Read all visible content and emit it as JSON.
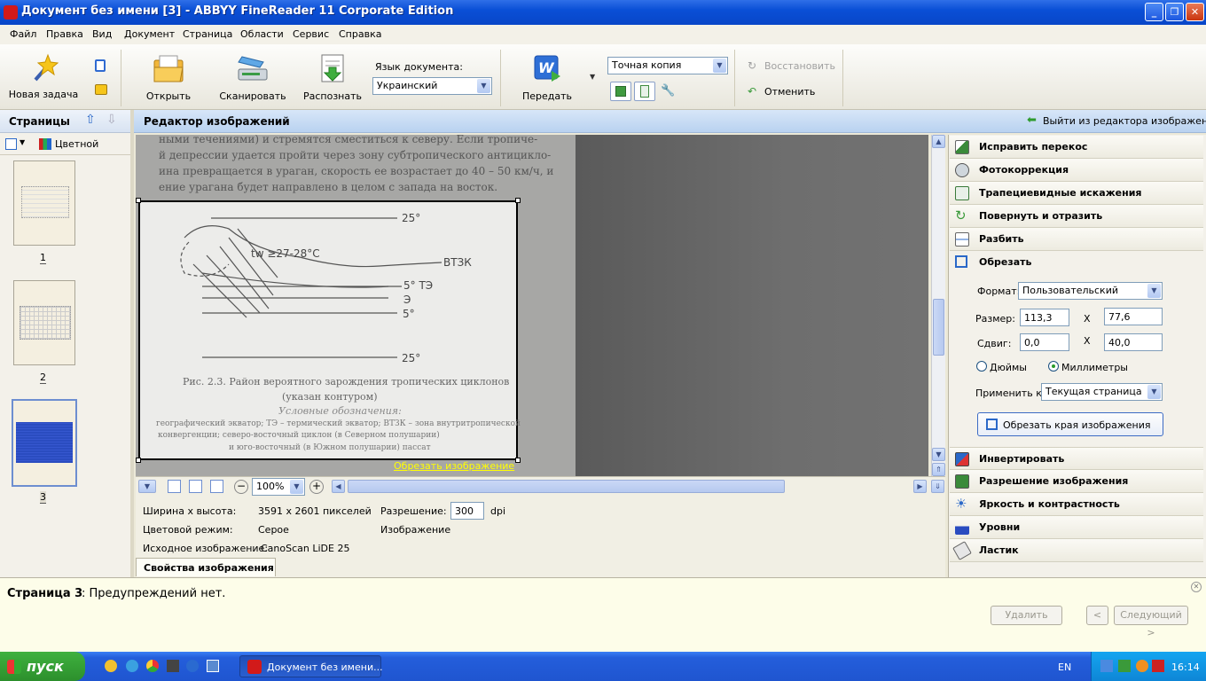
{
  "window": {
    "title": "Документ без имени [3] - ABBYY FineReader 11 Corporate Edition",
    "min": "_",
    "max": "❐",
    "close": "✕"
  },
  "menu": [
    "Файл",
    "Правка",
    "Вид",
    "Документ",
    "Страница",
    "Области",
    "Сервис",
    "Справка"
  ],
  "toolbar": {
    "new_task": "Новая задача",
    "open": "Открыть",
    "scan": "Сканировать",
    "recognize": "Распознать",
    "doc_language_label": "Язык документа:",
    "doc_language": "Украинский",
    "send": "Передать",
    "send_icon_letter": "W",
    "format": "Точная копия",
    "restore": "Восстановить",
    "undo": "Отменить"
  },
  "pages": {
    "title": "Страницы",
    "color_mode": "Цветной",
    "items": [
      {
        "num": "1"
      },
      {
        "num": "2"
      },
      {
        "num": "3"
      }
    ]
  },
  "editor": {
    "title": "Редактор изображений",
    "exit": "Выйти из редактора изображений"
  },
  "image_text": {
    "top_lines": [
      "ными течениями) и стремятся сместиться к северу. Если тропиче-",
      "й депрессии удается пройти через зону субтропического антицикло-",
      "ина превращается в ураган, скорость ее возрастает до 40 – 50 км/ч, и",
      "ение урагана будет направлено в целом с запада на восток."
    ],
    "sketch": {
      "lat_25_top": "25°",
      "tw": "tw ≥27-28°C",
      "vtzk": "ВТЗК",
      "te": "5° ТЭ",
      "e": "Э",
      "lat_5": "5°",
      "lat_25_bottom": "25°"
    },
    "caption_lines": [
      "Рис. 2.3. Район вероятного зарождения тропических циклонов",
      "(указан контуром)",
      "Условные обозначения:",
      "географический экватор; ТЭ – термический экватор; ВТЗК – зона внутритропической",
      "конвергенции;          северо-восточный циклон (в Северном полушарии)",
      "и юго-восточный (в Южном полушарии) пассат"
    ],
    "crop_link": "Обрезать изображение"
  },
  "zoom": {
    "value": "100%"
  },
  "properties": {
    "wh_label": "Ширина x высота:",
    "wh_value": "3591 x 2601 пикселей",
    "res_label": "Разрешение:",
    "res_value": "300",
    "res_unit": "dpi",
    "color_label": "Цветовой режим:",
    "color_value": "Серое",
    "image_label": "Изображение",
    "source_label": "Исходное изображение:",
    "source_value": "CanoScan LiDE 25",
    "tab": "Свойства изображения"
  },
  "tools": {
    "top": [
      {
        "label": "Исправить перекос",
        "icon": "deskew-icon"
      },
      {
        "label": "Фотокоррекция",
        "icon": "photo-correction-icon"
      },
      {
        "label": "Трапециевидные искажения",
        "icon": "trapezoid-icon"
      },
      {
        "label": "Повернуть и отразить",
        "icon": "rotate-icon"
      },
      {
        "label": "Разбить",
        "icon": "split-icon"
      },
      {
        "label": "Обрезать",
        "icon": "crop-icon"
      }
    ],
    "crop": {
      "format_label": "Формат:",
      "format_value": "Пользовательский",
      "size_label": "Размер:",
      "size_w": "113,3",
      "size_h": "77,6",
      "x": "X",
      "shift_label": "Сдвиг:",
      "shift_x": "0,0",
      "shift_y": "40,0",
      "unit_inches": "Дюймы",
      "unit_mm": "Миллиметры",
      "apply_label": "Применить к:",
      "apply_value": "Текущая страница",
      "button": "Обрезать края изображения"
    },
    "bottom": [
      {
        "label": "Инвертировать",
        "icon": "invert-icon"
      },
      {
        "label": "Разрешение изображения",
        "icon": "resolution-icon"
      },
      {
        "label": "Яркость и контрастность",
        "icon": "brightness-icon"
      },
      {
        "label": "Уровни",
        "icon": "levels-icon"
      },
      {
        "label": "Ластик",
        "icon": "eraser-icon"
      }
    ]
  },
  "status": {
    "page": "Страница 3",
    "message": ": Предупреждений нет.",
    "delete": "Удалить",
    "prev": "<",
    "next": "Следующий >"
  },
  "taskbar": {
    "start": "пуск",
    "task": "Документ без имени...",
    "lang": "EN",
    "time": "16:14"
  },
  "colors": {
    "title_blue": "#0a4fd6",
    "editor_header": "#c7dcf4",
    "taskbar_blue": "#245edb",
    "start_green": "#3a9e3a",
    "link_yellow": "#ffff00"
  }
}
